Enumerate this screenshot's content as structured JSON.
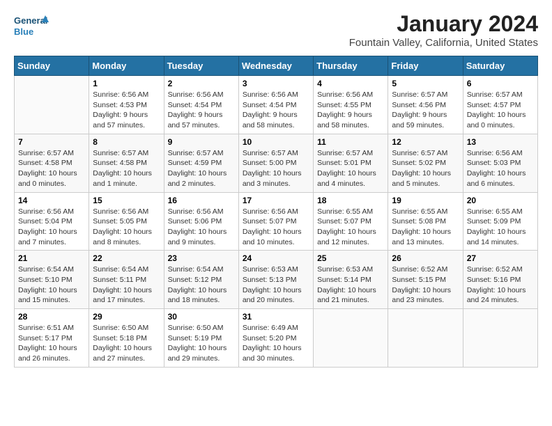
{
  "logo": {
    "line1": "General",
    "line2": "Blue"
  },
  "title": "January 2024",
  "subtitle": "Fountain Valley, California, United States",
  "days_of_week": [
    "Sunday",
    "Monday",
    "Tuesday",
    "Wednesday",
    "Thursday",
    "Friday",
    "Saturday"
  ],
  "weeks": [
    [
      {
        "day": "",
        "sunrise": "",
        "sunset": "",
        "daylight": ""
      },
      {
        "day": "1",
        "sunrise": "Sunrise: 6:56 AM",
        "sunset": "Sunset: 4:53 PM",
        "daylight": "Daylight: 9 hours and 57 minutes."
      },
      {
        "day": "2",
        "sunrise": "Sunrise: 6:56 AM",
        "sunset": "Sunset: 4:54 PM",
        "daylight": "Daylight: 9 hours and 57 minutes."
      },
      {
        "day": "3",
        "sunrise": "Sunrise: 6:56 AM",
        "sunset": "Sunset: 4:54 PM",
        "daylight": "Daylight: 9 hours and 58 minutes."
      },
      {
        "day": "4",
        "sunrise": "Sunrise: 6:56 AM",
        "sunset": "Sunset: 4:55 PM",
        "daylight": "Daylight: 9 hours and 58 minutes."
      },
      {
        "day": "5",
        "sunrise": "Sunrise: 6:57 AM",
        "sunset": "Sunset: 4:56 PM",
        "daylight": "Daylight: 9 hours and 59 minutes."
      },
      {
        "day": "6",
        "sunrise": "Sunrise: 6:57 AM",
        "sunset": "Sunset: 4:57 PM",
        "daylight": "Daylight: 10 hours and 0 minutes."
      }
    ],
    [
      {
        "day": "7",
        "sunrise": "Sunrise: 6:57 AM",
        "sunset": "Sunset: 4:58 PM",
        "daylight": "Daylight: 10 hours and 0 minutes."
      },
      {
        "day": "8",
        "sunrise": "Sunrise: 6:57 AM",
        "sunset": "Sunset: 4:58 PM",
        "daylight": "Daylight: 10 hours and 1 minute."
      },
      {
        "day": "9",
        "sunrise": "Sunrise: 6:57 AM",
        "sunset": "Sunset: 4:59 PM",
        "daylight": "Daylight: 10 hours and 2 minutes."
      },
      {
        "day": "10",
        "sunrise": "Sunrise: 6:57 AM",
        "sunset": "Sunset: 5:00 PM",
        "daylight": "Daylight: 10 hours and 3 minutes."
      },
      {
        "day": "11",
        "sunrise": "Sunrise: 6:57 AM",
        "sunset": "Sunset: 5:01 PM",
        "daylight": "Daylight: 10 hours and 4 minutes."
      },
      {
        "day": "12",
        "sunrise": "Sunrise: 6:57 AM",
        "sunset": "Sunset: 5:02 PM",
        "daylight": "Daylight: 10 hours and 5 minutes."
      },
      {
        "day": "13",
        "sunrise": "Sunrise: 6:56 AM",
        "sunset": "Sunset: 5:03 PM",
        "daylight": "Daylight: 10 hours and 6 minutes."
      }
    ],
    [
      {
        "day": "14",
        "sunrise": "Sunrise: 6:56 AM",
        "sunset": "Sunset: 5:04 PM",
        "daylight": "Daylight: 10 hours and 7 minutes."
      },
      {
        "day": "15",
        "sunrise": "Sunrise: 6:56 AM",
        "sunset": "Sunset: 5:05 PM",
        "daylight": "Daylight: 10 hours and 8 minutes."
      },
      {
        "day": "16",
        "sunrise": "Sunrise: 6:56 AM",
        "sunset": "Sunset: 5:06 PM",
        "daylight": "Daylight: 10 hours and 9 minutes."
      },
      {
        "day": "17",
        "sunrise": "Sunrise: 6:56 AM",
        "sunset": "Sunset: 5:07 PM",
        "daylight": "Daylight: 10 hours and 10 minutes."
      },
      {
        "day": "18",
        "sunrise": "Sunrise: 6:55 AM",
        "sunset": "Sunset: 5:07 PM",
        "daylight": "Daylight: 10 hours and 12 minutes."
      },
      {
        "day": "19",
        "sunrise": "Sunrise: 6:55 AM",
        "sunset": "Sunset: 5:08 PM",
        "daylight": "Daylight: 10 hours and 13 minutes."
      },
      {
        "day": "20",
        "sunrise": "Sunrise: 6:55 AM",
        "sunset": "Sunset: 5:09 PM",
        "daylight": "Daylight: 10 hours and 14 minutes."
      }
    ],
    [
      {
        "day": "21",
        "sunrise": "Sunrise: 6:54 AM",
        "sunset": "Sunset: 5:10 PM",
        "daylight": "Daylight: 10 hours and 15 minutes."
      },
      {
        "day": "22",
        "sunrise": "Sunrise: 6:54 AM",
        "sunset": "Sunset: 5:11 PM",
        "daylight": "Daylight: 10 hours and 17 minutes."
      },
      {
        "day": "23",
        "sunrise": "Sunrise: 6:54 AM",
        "sunset": "Sunset: 5:12 PM",
        "daylight": "Daylight: 10 hours and 18 minutes."
      },
      {
        "day": "24",
        "sunrise": "Sunrise: 6:53 AM",
        "sunset": "Sunset: 5:13 PM",
        "daylight": "Daylight: 10 hours and 20 minutes."
      },
      {
        "day": "25",
        "sunrise": "Sunrise: 6:53 AM",
        "sunset": "Sunset: 5:14 PM",
        "daylight": "Daylight: 10 hours and 21 minutes."
      },
      {
        "day": "26",
        "sunrise": "Sunrise: 6:52 AM",
        "sunset": "Sunset: 5:15 PM",
        "daylight": "Daylight: 10 hours and 23 minutes."
      },
      {
        "day": "27",
        "sunrise": "Sunrise: 6:52 AM",
        "sunset": "Sunset: 5:16 PM",
        "daylight": "Daylight: 10 hours and 24 minutes."
      }
    ],
    [
      {
        "day": "28",
        "sunrise": "Sunrise: 6:51 AM",
        "sunset": "Sunset: 5:17 PM",
        "daylight": "Daylight: 10 hours and 26 minutes."
      },
      {
        "day": "29",
        "sunrise": "Sunrise: 6:50 AM",
        "sunset": "Sunset: 5:18 PM",
        "daylight": "Daylight: 10 hours and 27 minutes."
      },
      {
        "day": "30",
        "sunrise": "Sunrise: 6:50 AM",
        "sunset": "Sunset: 5:19 PM",
        "daylight": "Daylight: 10 hours and 29 minutes."
      },
      {
        "day": "31",
        "sunrise": "Sunrise: 6:49 AM",
        "sunset": "Sunset: 5:20 PM",
        "daylight": "Daylight: 10 hours and 30 minutes."
      },
      {
        "day": "",
        "sunrise": "",
        "sunset": "",
        "daylight": ""
      },
      {
        "day": "",
        "sunrise": "",
        "sunset": "",
        "daylight": ""
      },
      {
        "day": "",
        "sunrise": "",
        "sunset": "",
        "daylight": ""
      }
    ]
  ]
}
